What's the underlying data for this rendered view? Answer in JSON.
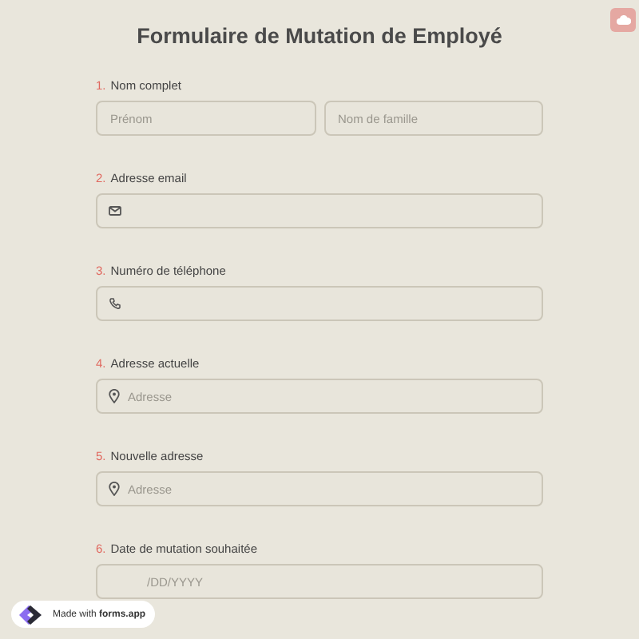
{
  "title": "Formulaire de Mutation de Employé",
  "questions": [
    {
      "number": "1.",
      "label": "Nom complet",
      "kind": "name",
      "inputs": [
        {
          "placeholder": "Prénom"
        },
        {
          "placeholder": "Nom de famille"
        }
      ]
    },
    {
      "number": "2.",
      "label": "Adresse email",
      "kind": "email"
    },
    {
      "number": "3.",
      "label": "Numéro de téléphone",
      "kind": "phone"
    },
    {
      "number": "4.",
      "label": "Adresse actuelle",
      "kind": "address",
      "inputs": [
        {
          "placeholder": "Adresse"
        }
      ]
    },
    {
      "number": "5.",
      "label": "Nouvelle adresse",
      "kind": "address",
      "inputs": [
        {
          "placeholder": "Adresse"
        }
      ]
    },
    {
      "number": "6.",
      "label": "Date de mutation souhaitée",
      "kind": "date",
      "inputs": [
        {
          "placeholder": "/DD/YYYY"
        }
      ]
    }
  ],
  "badge": "Made with **forms.app**"
}
